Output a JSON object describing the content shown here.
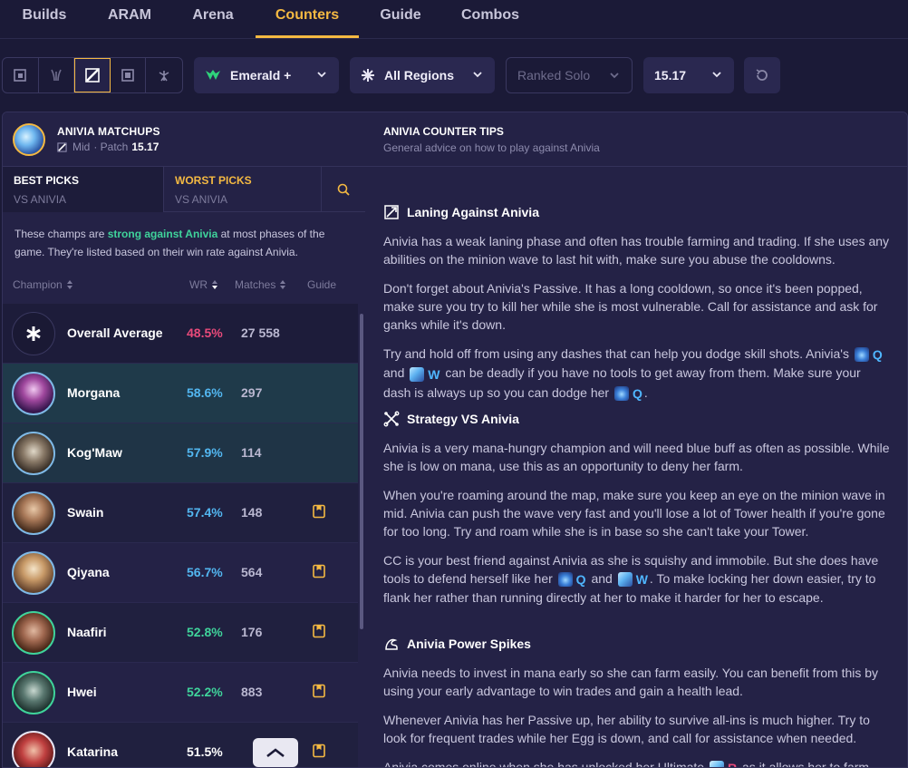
{
  "nav": {
    "tabs": [
      {
        "label": "Builds"
      },
      {
        "label": "ARAM"
      },
      {
        "label": "Arena"
      },
      {
        "label": "Counters"
      },
      {
        "label": "Guide"
      },
      {
        "label": "Combos"
      }
    ],
    "active_tab": "Counters"
  },
  "filters": {
    "roles": [
      "top-lane-icon",
      "jungle-icon",
      "mid-lane-icon",
      "bot-lane-icon",
      "support-icon"
    ],
    "active_role": "mid-lane-icon",
    "rank": "Emerald +",
    "region": "All Regions",
    "queue": "Ranked Solo",
    "patch": "15.17"
  },
  "matchups": {
    "title": "ANIVIA MATCHUPS",
    "role": "Mid",
    "patch_label": "· Patch",
    "patch": "15.17"
  },
  "tips_header": {
    "title": "ANIVIA COUNTER TIPS",
    "subtitle": "General advice on how to play against Anivia"
  },
  "picks": {
    "best_line1": "BEST PICKS",
    "best_line2": "VS ANIVIA",
    "worst_line1": "WORST PICKS",
    "worst_line2": "VS ANIVIA"
  },
  "description": {
    "pre": "These champs are ",
    "highlight": "strong against Anivia",
    "post": " at most phases of the game. They're listed based on their win rate against Anivia."
  },
  "columns": {
    "champion": "Champion",
    "wr": "WR",
    "matches": "Matches",
    "guide": "Guide"
  },
  "rows": [
    {
      "name": "Overall Average",
      "wr": "48.5%",
      "matches": "27 558",
      "guide": false,
      "wr_color": "#e84a7a"
    },
    {
      "name": "Morgana",
      "wr": "58.6%",
      "matches": "297",
      "guide": false,
      "wr_color": "#52b6f0"
    },
    {
      "name": "Kog'Maw",
      "wr": "57.9%",
      "matches": "114",
      "guide": false,
      "wr_color": "#52b6f0"
    },
    {
      "name": "Swain",
      "wr": "57.4%",
      "matches": "148",
      "guide": true,
      "wr_color": "#52b6f0"
    },
    {
      "name": "Qiyana",
      "wr": "56.7%",
      "matches": "564",
      "guide": true,
      "wr_color": "#52b6f0"
    },
    {
      "name": "Naafiri",
      "wr": "52.8%",
      "matches": "176",
      "guide": true,
      "wr_color": "#3fd39b"
    },
    {
      "name": "Hwei",
      "wr": "52.2%",
      "matches": "883",
      "guide": true,
      "wr_color": "#3fd39b"
    },
    {
      "name": "Katarina",
      "wr": "51.5%",
      "matches": "",
      "guide": true,
      "wr_color": "#ffffff"
    }
  ],
  "tips": {
    "laning": {
      "title": "Laning Against Anivia",
      "p1": "Anivia has a weak laning phase and often has trouble farming and trading. If she uses any abilities on the minion wave to last hit with, make sure you abuse the cooldowns.",
      "p2": "Don't forget about Anivia's Passive. It has a long cooldown, so once it's been popped, make sure you try to kill her while she is most vulnerable. Call for assistance and ask for ganks while it's down.",
      "p3a": "Try and hold off from using any dashes that can help you dodge skill shots. Anivia's ",
      "p3b": " and ",
      "p3c": " can be deadly if you have no tools to get away from them. Make sure your dash is always up so you can dodge her ",
      "p3d": "."
    },
    "strategy": {
      "title": "Strategy VS Anivia",
      "p1": "Anivia is a very mana-hungry champion and will need blue buff as often as possible. While she is low on mana, use this as an opportunity to deny her farm.",
      "p2": "When you're roaming around the map, make sure you keep an eye on the minion wave in mid. Anivia can push the wave very fast and you'll lose a lot of Tower health if you're gone for too long. Try and roam while she is in base so she can't take your Tower.",
      "p3a": "CC is your best friend against Anivia as she is squishy and immobile. But she does have tools to defend herself like her ",
      "p3b": " and ",
      "p3c": ". To make locking her down easier, try to flank her rather than running directly at her to make it harder for her to escape."
    },
    "spikes": {
      "title": "Anivia Power Spikes",
      "p1": "Anivia needs to invest in mana early so she can farm easily. You can benefit from this by using your early advantage to win trades and gain a health lead.",
      "p2": "Whenever Anivia has her Passive up, her ability to survive all-ins is much higher. Try to look for frequent trades while her Egg is down, and call for assistance when needed.",
      "p3a": "Anivia comes online when she has unlocked her Ultimate ",
      "p3b": " as it allows her to farm"
    },
    "keys": {
      "q": "Q",
      "w": "W",
      "r": "R"
    }
  }
}
